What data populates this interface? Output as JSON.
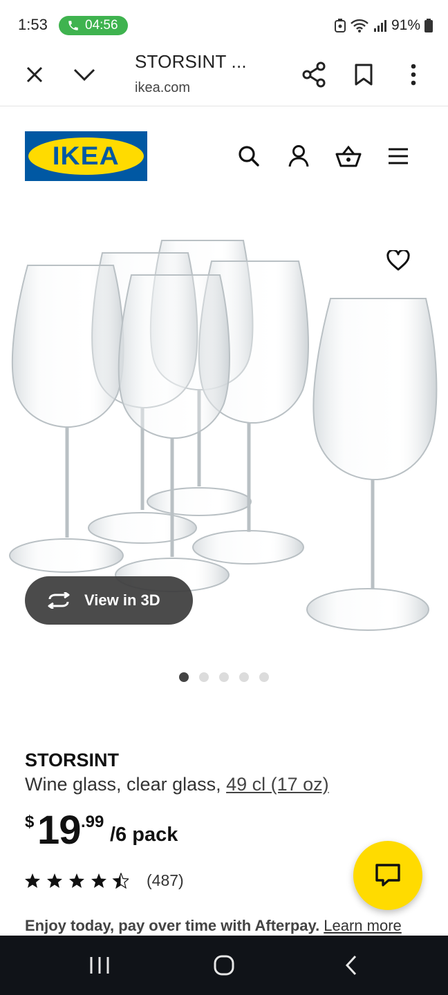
{
  "status": {
    "time": "1:53",
    "call_duration": "04:56",
    "battery": "91%"
  },
  "browser": {
    "tab_title": "STORSINT ...",
    "domain": "ikea.com",
    "icons": [
      "close-icon",
      "chevron-down-icon",
      "share-icon",
      "bookmark-icon",
      "more-vert-icon"
    ]
  },
  "header": {
    "logo_text": "IKEA",
    "logo_reg": "®",
    "colors": {
      "logo_bg": "#0058a3",
      "logo_oval": "#ffdb00"
    },
    "icons": [
      "search-icon",
      "account-icon",
      "cart-icon",
      "menu-icon"
    ]
  },
  "gallery": {
    "view3d_label": "View in 3D",
    "slide_count": 5,
    "active_slide": 1
  },
  "product": {
    "name": "STORSINT",
    "desc_text": "Wine glass, clear glass, ",
    "desc_size": "49 cl (17 oz)",
    "price_currency": "$",
    "price_integer": "19",
    "price_decimal": ".99",
    "price_unit": "/6 pack",
    "rating_value": 4.5,
    "rating_max": 5,
    "review_count": "(487)",
    "afterpay_text": "Enjoy today, pay over time with Afterpay.",
    "afterpay_link": "Learn more"
  },
  "chat": {
    "color": "#ffdb00"
  },
  "nav": {
    "icons": [
      "recent-apps-icon",
      "home-icon",
      "back-icon"
    ]
  }
}
